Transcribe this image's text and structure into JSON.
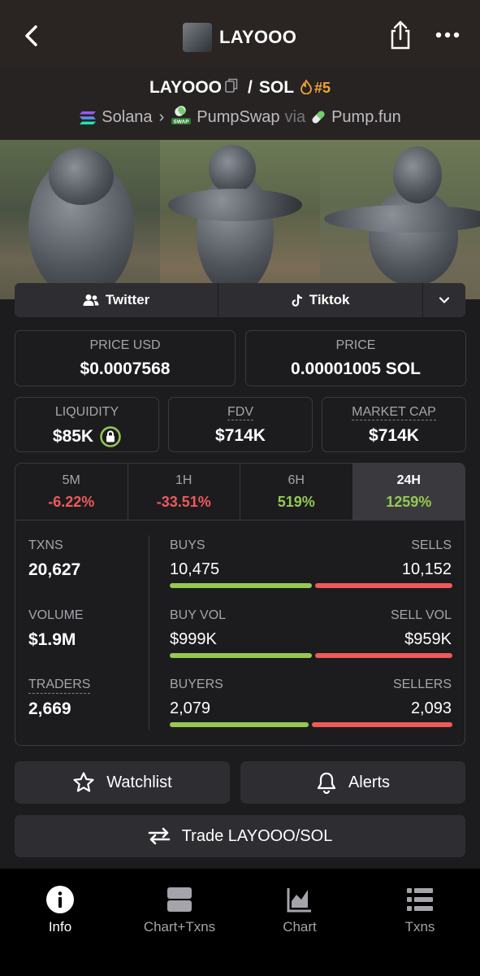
{
  "header": {
    "title": "LAYOOO"
  },
  "pair": {
    "base": "LAYOOO",
    "sep": "/",
    "quote": "SOL",
    "rank": "#5",
    "chain": "Solana",
    "dex": "PumpSwap",
    "dex_badge": "SWAP",
    "via": "via",
    "launchpad": "Pump.fun"
  },
  "socials": {
    "twitter": "Twitter",
    "tiktok": "Tiktok"
  },
  "price": {
    "usd_label": "PRICE USD",
    "usd_value": "$0.0007568",
    "native_label": "PRICE",
    "native_value": "0.00001005 SOL"
  },
  "metrics": {
    "liquidity_label": "LIQUIDITY",
    "liquidity_value": "$85K",
    "fdv_label": "FDV",
    "fdv_value": "$714K",
    "mcap_label": "MARKET CAP",
    "mcap_value": "$714K"
  },
  "timeframes": [
    {
      "label": "5M",
      "value": "-6.22%"
    },
    {
      "label": "1H",
      "value": "-33.51%"
    },
    {
      "label": "6H",
      "value": "519%"
    },
    {
      "label": "24H",
      "value": "1259%"
    }
  ],
  "stats": {
    "txns_label": "TXNS",
    "txns_value": "20,627",
    "volume_label": "VOLUME",
    "volume_value": "$1.9M",
    "traders_label": "TRADERS",
    "traders_value": "2,669",
    "buys_label": "BUYS",
    "buys_value": "10,475",
    "sells_label": "SELLS",
    "sells_value": "10,152",
    "buyvol_label": "BUY VOL",
    "buyvol_value": "$999K",
    "sellvol_label": "SELL VOL",
    "sellvol_value": "$959K",
    "buyers_label": "BUYERS",
    "buyers_value": "2,079",
    "sellers_label": "SELLERS",
    "sellers_value": "2,093",
    "buys_fraction": 0.508,
    "buyvol_fraction": 0.51,
    "buyers_fraction": 0.498
  },
  "actions": {
    "watchlist": "Watchlist",
    "alerts": "Alerts",
    "trade": "Trade LAYOOO/SOL"
  },
  "nav": [
    {
      "label": "Info",
      "icon": "info-icon",
      "active": true
    },
    {
      "label": "Chart+Txns",
      "icon": "chart-txns-icon"
    },
    {
      "label": "Chart",
      "icon": "chart-icon"
    },
    {
      "label": "Txns",
      "icon": "list-icon"
    }
  ],
  "colors": {
    "positive": "#95c952",
    "negative": "#ef5a5a",
    "rank": "#f2a33a"
  }
}
